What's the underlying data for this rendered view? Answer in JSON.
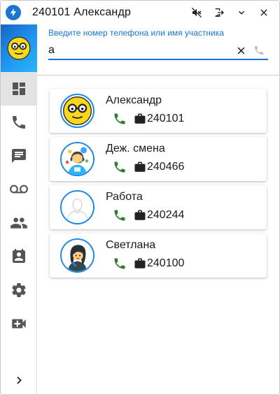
{
  "window": {
    "title": "240101 Александр",
    "icons": [
      "app-logo-icon",
      "mute-icon",
      "logout-icon",
      "chevron-down-icon",
      "close-icon"
    ]
  },
  "colors": {
    "accent": "#1976d2",
    "call_green": "#2e7d32",
    "icon_gray": "#555555"
  },
  "sidebar": {
    "items": [
      {
        "name": "dashboard",
        "icon": "dashboard-icon",
        "active": true
      },
      {
        "name": "calls",
        "icon": "phone-icon",
        "active": false
      },
      {
        "name": "chat",
        "icon": "chat-icon",
        "active": false
      },
      {
        "name": "voicemail",
        "icon": "voicemail-icon",
        "active": false
      },
      {
        "name": "contacts",
        "icon": "people-icon",
        "active": false
      },
      {
        "name": "calendar",
        "icon": "calendar-user-icon",
        "active": false
      },
      {
        "name": "settings",
        "icon": "gear-icon",
        "active": false
      },
      {
        "name": "video",
        "icon": "video-add-icon",
        "active": false
      }
    ],
    "expand_icon": "chevron-right-icon"
  },
  "search": {
    "label": "Введите номер телефона или имя участника",
    "value": "а"
  },
  "contacts": [
    {
      "name": "Александр",
      "number": "240101",
      "avatar": "emoji-glasses"
    },
    {
      "name": "Деж. смена",
      "number": "240466",
      "avatar": "operator"
    },
    {
      "name": "Работа",
      "number": "240244",
      "avatar": "placeholder"
    },
    {
      "name": "Светлана",
      "number": "240100",
      "avatar": "woman"
    }
  ]
}
